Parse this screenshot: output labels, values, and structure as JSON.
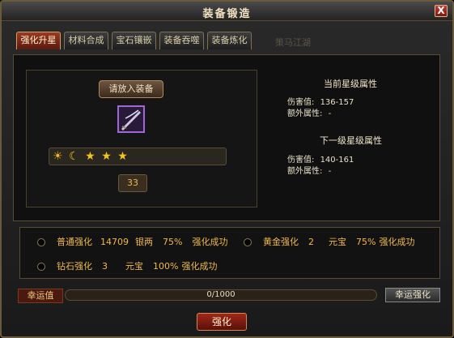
{
  "window": {
    "title": "装备锻造",
    "close_label": "X"
  },
  "tabs": [
    {
      "label": "强化升星",
      "active": true
    },
    {
      "label": "材料合成",
      "active": false
    },
    {
      "label": "宝石镶嵌",
      "active": false
    },
    {
      "label": "装备吞噬",
      "active": false
    },
    {
      "label": "装备炼化",
      "active": false
    }
  ],
  "faded_tab": "策马江湖",
  "slot": {
    "put_label": "请放入装备",
    "stars": [
      "☀",
      "☾",
      "★",
      "★",
      "★"
    ],
    "count": "33"
  },
  "current": {
    "heading": "当前星级属性",
    "damage_label": "伤害值:",
    "damage": "136-157",
    "extra_label": "额外属性:",
    "extra": "-"
  },
  "next": {
    "heading": "下一级星级属性",
    "damage_label": "伤害值:",
    "damage": "140-161",
    "extra_label": "额外属性:",
    "extra": "-"
  },
  "options": [
    {
      "name": "普通强化",
      "amount": "14709",
      "currency": "银两",
      "rate": "75%",
      "result": "强化成功"
    },
    {
      "name": "黄金强化",
      "amount": "2",
      "currency": "元宝",
      "rate": "75%",
      "result": "强化成功"
    },
    {
      "name": "钻石强化",
      "amount": "3",
      "currency": "元宝",
      "rate": "100%",
      "result": "强化成功"
    }
  ],
  "luck": {
    "label": "幸运值",
    "text": "0/1000",
    "fraction": 0.0,
    "button_label": "幸运强化"
  },
  "enhance_button": "强化",
  "colors": {
    "accent": "#f0b84c",
    "active_tab": "#9b3a24",
    "item_border": "#a067d8"
  }
}
